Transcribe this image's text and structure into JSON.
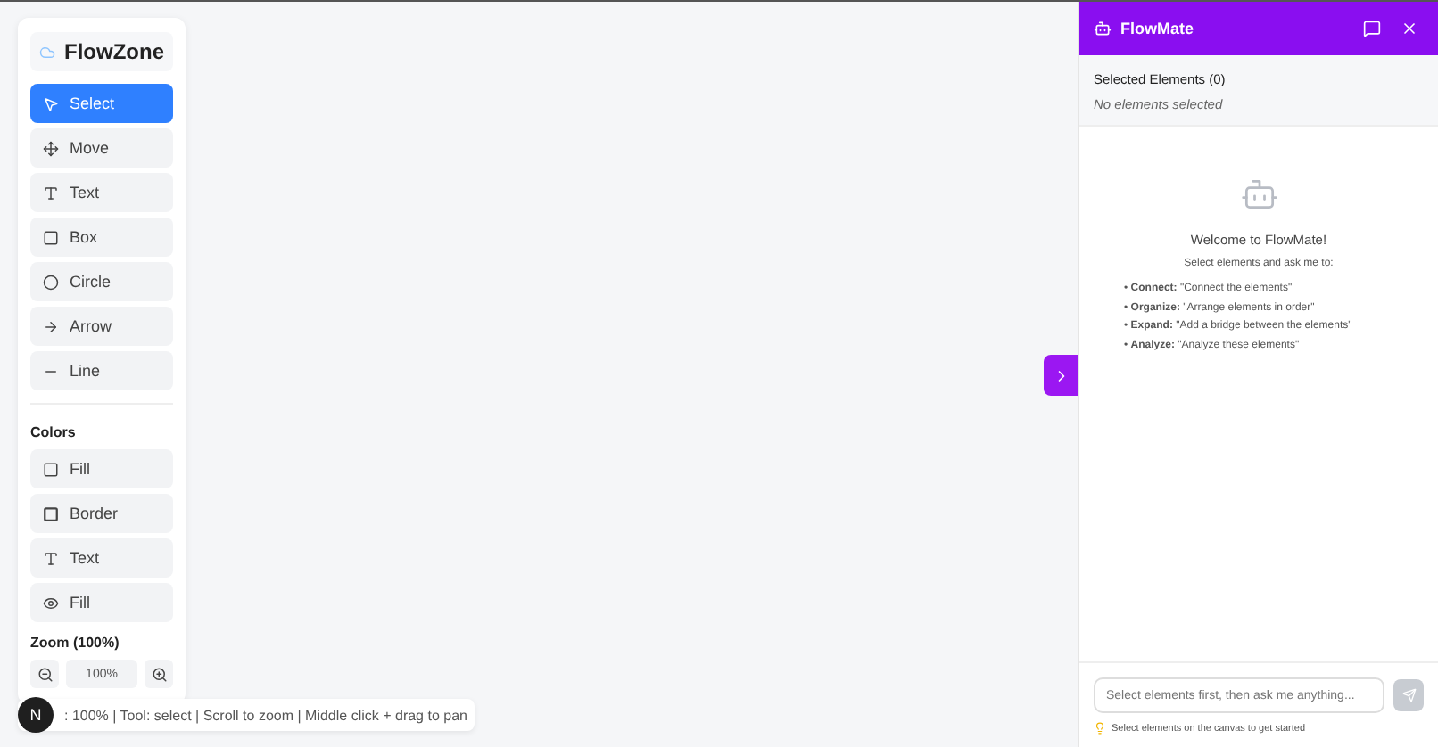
{
  "sidebar": {
    "logo": "FlowZone",
    "tools": [
      {
        "kind": "select",
        "label": "Select",
        "selected": true
      },
      {
        "kind": "move",
        "label": "Move",
        "selected": false
      },
      {
        "kind": "text",
        "label": "Text",
        "selected": false
      },
      {
        "kind": "box",
        "label": "Box",
        "selected": false
      },
      {
        "kind": "circle",
        "label": "Circle",
        "selected": false
      },
      {
        "kind": "arrow",
        "label": "Arrow",
        "selected": false
      },
      {
        "kind": "line",
        "label": "Line",
        "selected": false
      }
    ],
    "colors_heading": "Colors",
    "colors": [
      {
        "kind": "fill",
        "label": "Fill"
      },
      {
        "kind": "border",
        "label": "Border"
      },
      {
        "kind": "text",
        "label": "Text"
      },
      {
        "kind": "opacity",
        "label": "Fill"
      }
    ],
    "zoom_heading": "Zoom (100%)",
    "zoom_value": "100%"
  },
  "status_bar": {
    "avatar": "N",
    "text": ": 100% | Tool: select | Scroll to zoom | Middle click + drag to pan"
  },
  "assistant": {
    "title": "FlowMate",
    "selected_heading": "Selected Elements (0)",
    "selected_empty": "No elements selected",
    "welcome": "Welcome to FlowMate!",
    "intro": "Select elements and ask me to:",
    "examples": [
      "• **Connect:** \"Connect the elements\"",
      "• **Organize:** \"Arrange elements in order\"",
      "• **Expand:** \"Add a bridge between the elements\"",
      "• **Analyze:** \"Analyze these elements\""
    ],
    "input": {
      "placeholder": "Select elements first, then ask me anything..."
    },
    "hint": "Select elements on the canvas to get started"
  }
}
